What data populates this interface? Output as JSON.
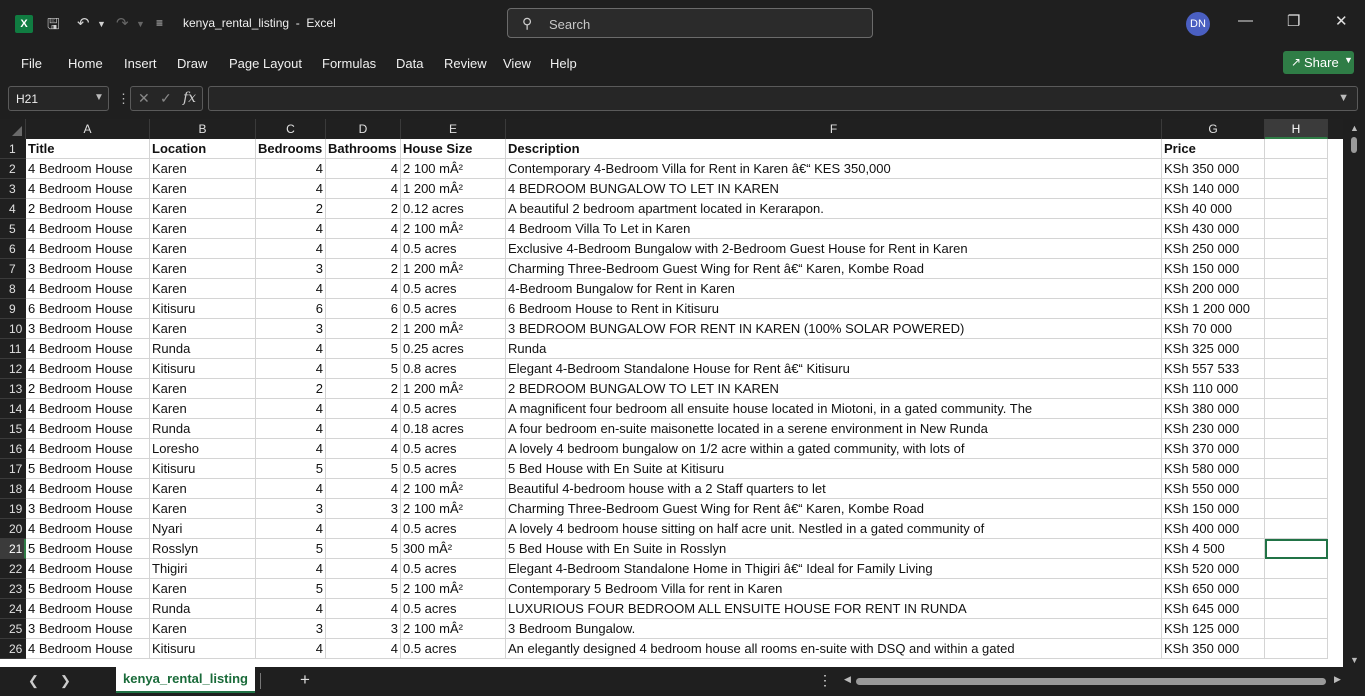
{
  "app": {
    "logo": "X",
    "doc_name": "kenya_rental_listing",
    "title_separator": "-",
    "app_name": "Excel",
    "search_placeholder": "Search",
    "user_initials": "DN",
    "share_label": "Share",
    "accent_color": "#107c41"
  },
  "menu": [
    "File",
    "Home",
    "Insert",
    "Draw",
    "Page Layout",
    "Formulas",
    "Data",
    "Review",
    "View",
    "Help"
  ],
  "formula_bar": {
    "name_box": "H21",
    "formula": ""
  },
  "columns": [
    "A",
    "B",
    "C",
    "D",
    "E",
    "F",
    "G",
    "H"
  ],
  "selected_column": "H",
  "selected_row": 21,
  "active_cell": "H21",
  "rows": [
    {
      "n": 1,
      "cells": [
        "Title",
        "Location",
        "Bedrooms",
        "Bathrooms",
        "House Size",
        "Description",
        "Price",
        ""
      ]
    },
    {
      "n": 2,
      "cells": [
        "4 Bedroom House",
        "Karen",
        "4",
        "4",
        "2 100 mÂ²",
        "Contemporary 4-Bedroom Villa for Rent in Karen â€“ KES 350,000",
        "KSh 350 000",
        ""
      ]
    },
    {
      "n": 3,
      "cells": [
        "4 Bedroom House",
        "Karen",
        "4",
        "4",
        "1 200 mÂ²",
        "4 BEDROOM BUNGALOW TO LET IN KAREN",
        "KSh 140 000",
        ""
      ]
    },
    {
      "n": 4,
      "cells": [
        "2 Bedroom House",
        "Karen",
        "2",
        "2",
        "0.12 acres",
        "A beautiful 2 bedroom apartment located in Kerarapon.",
        "KSh 40 000",
        ""
      ]
    },
    {
      "n": 5,
      "cells": [
        "4 Bedroom House",
        "Karen",
        "4",
        "4",
        "2 100 mÂ²",
        "4 Bedroom Villa To Let in Karen",
        "KSh 430 000",
        ""
      ]
    },
    {
      "n": 6,
      "cells": [
        "4 Bedroom House",
        "Karen",
        "4",
        "4",
        "0.5 acres",
        "Exclusive 4-Bedroom Bungalow with 2-Bedroom Guest House for Rent in Karen",
        "KSh 250 000",
        ""
      ]
    },
    {
      "n": 7,
      "cells": [
        "3 Bedroom House",
        "Karen",
        "3",
        "2",
        "1 200 mÂ²",
        "Charming Three-Bedroom Guest Wing for Rent â€“ Karen, Kombe Road",
        "KSh 150 000",
        ""
      ]
    },
    {
      "n": 8,
      "cells": [
        "4 Bedroom House",
        "Karen",
        "4",
        "4",
        "0.5 acres",
        "4-Bedroom Bungalow for Rent in Karen",
        "KSh 200 000",
        ""
      ]
    },
    {
      "n": 9,
      "cells": [
        "6 Bedroom House",
        "Kitisuru",
        "6",
        "6",
        "0.5 acres",
        "6 Bedroom House to Rent in Kitisuru",
        "KSh 1 200 000",
        ""
      ]
    },
    {
      "n": 10,
      "cells": [
        "3 Bedroom House",
        "Karen",
        "3",
        "2",
        "1 200 mÂ²",
        "3 BEDROOM BUNGALOW FOR RENT IN KAREN (100% SOLAR POWERED)",
        "KSh 70 000",
        ""
      ]
    },
    {
      "n": 11,
      "cells": [
        "4 Bedroom House",
        "Runda",
        "4",
        "5",
        "0.25 acres",
        "Runda",
        "KSh 325 000",
        ""
      ]
    },
    {
      "n": 12,
      "cells": [
        "4 Bedroom House",
        "Kitisuru",
        "4",
        "5",
        "0.8 acres",
        "Elegant 4-Bedroom Standalone House for Rent â€“ Kitisuru",
        "KSh 557 533",
        ""
      ]
    },
    {
      "n": 13,
      "cells": [
        "2 Bedroom House",
        "Karen",
        "2",
        "2",
        "1 200 mÂ²",
        "2 BEDROOM BUNGALOW TO LET IN KAREN",
        "KSh 110 000",
        ""
      ]
    },
    {
      "n": 14,
      "cells": [
        "4 Bedroom House",
        "Karen",
        "4",
        "4",
        "0.5 acres",
        "A magnificent four bedroom all ensuite house located in Miotoni, in a gated community. The",
        "KSh 380 000",
        ""
      ]
    },
    {
      "n": 15,
      "cells": [
        "4 Bedroom House",
        "Runda",
        "4",
        "4",
        "0.18 acres",
        "A four bedroom  en-suite maisonette located in a serene environment in New Runda",
        "KSh 230 000",
        ""
      ]
    },
    {
      "n": 16,
      "cells": [
        "4 Bedroom House",
        "Loresho",
        "4",
        "4",
        "0.5 acres",
        "A lovely 4 bedroom bungalow on 1/2 acre within a gated community, with lots of",
        "KSh 370 000",
        ""
      ]
    },
    {
      "n": 17,
      "cells": [
        "5 Bedroom House",
        "Kitisuru",
        "5",
        "5",
        "0.5 acres",
        "5 Bed House with En Suite at Kitisuru",
        "KSh 580 000",
        ""
      ]
    },
    {
      "n": 18,
      "cells": [
        "4 Bedroom House",
        "Karen",
        "4",
        "4",
        "2 100 mÂ²",
        "Beautiful 4-bedroom house with a 2 Staff quarters to let",
        "KSh 550 000",
        ""
      ]
    },
    {
      "n": 19,
      "cells": [
        "3 Bedroom House",
        "Karen",
        "3",
        "3",
        "2 100 mÂ²",
        "Charming Three-Bedroom Guest Wing for Rent â€“ Karen, Kombe Road",
        "KSh 150 000",
        ""
      ]
    },
    {
      "n": 20,
      "cells": [
        "4 Bedroom House",
        "Nyari",
        "4",
        "4",
        "0.5 acres",
        "A lovely 4 bedroom house sitting on half acre unit. Nestled in a gated community of",
        "KSh 400 000",
        ""
      ]
    },
    {
      "n": 21,
      "cells": [
        "5 Bedroom House",
        "Rosslyn",
        "5",
        "5",
        "300 mÂ²",
        "5 Bed House with En Suite in Rosslyn",
        "KSh 4 500",
        ""
      ]
    },
    {
      "n": 22,
      "cells": [
        "4 Bedroom House",
        "Thigiri",
        "4",
        "4",
        "0.5 acres",
        "Elegant 4-Bedroom Standalone Home in Thigiri â€“ Ideal for Family Living",
        "KSh 520 000",
        ""
      ]
    },
    {
      "n": 23,
      "cells": [
        "5 Bedroom House",
        "Karen",
        "5",
        "5",
        "2 100 mÂ²",
        "Contemporary 5 Bedroom Villa for rent in Karen",
        "KSh 650 000",
        ""
      ]
    },
    {
      "n": 24,
      "cells": [
        "4 Bedroom House",
        "Runda",
        "4",
        "4",
        "0.5 acres",
        "LUXURIOUS FOUR BEDROOM ALL ENSUITE HOUSE FOR RENT IN RUNDA",
        "KSh 645 000",
        ""
      ]
    },
    {
      "n": 25,
      "cells": [
        "3 Bedroom House",
        "Karen",
        "3",
        "3",
        "2 100 mÂ²",
        "3 Bedroom Bungalow.",
        "KSh 125 000",
        ""
      ]
    },
    {
      "n": 26,
      "cells": [
        "4 Bedroom House",
        "Kitisuru",
        "4",
        "4",
        "0.5 acres",
        "An elegantly designed 4 bedroom house all rooms en-suite with DSQ and within a gated",
        "KSh 350 000",
        ""
      ]
    }
  ],
  "sheets": [
    {
      "name": "kenya_rental_listing",
      "active": true
    }
  ]
}
